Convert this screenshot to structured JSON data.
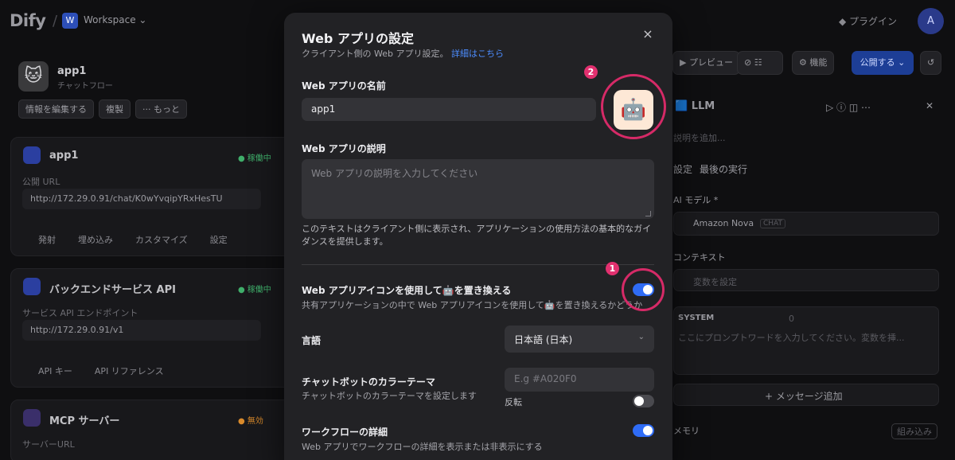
{
  "topbar": {
    "logo": "Dify",
    "workspace_badge": "W",
    "workspace_name": "Workspace ⌄",
    "plugins_label": "プラグイン",
    "avatar_letter": "A"
  },
  "left_panel": {
    "app_icon": "🐱",
    "app_name": "app1",
    "app_type": "チャットフロー",
    "chips": [
      "情報を編集する",
      "複製",
      "··· もっと"
    ],
    "webapp_card": {
      "title": "app1",
      "status": "● 稼働中",
      "url_label": "公開 URL",
      "url": "http://172.29.0.91/chat/K0wYvqipYRxHesTU",
      "actions": [
        "発射",
        "埋め込み",
        "カスタマイズ",
        "設定"
      ]
    },
    "api_card": {
      "title": "バックエンドサービス API",
      "status": "● 稼働中",
      "url_label": "サービス API エンドポイント",
      "url": "http://172.29.0.91/v1",
      "actions": [
        "API キー",
        "API リファレンス"
      ]
    },
    "mcp_card": {
      "title": "MCP サーバー",
      "status": "● 無効",
      "url_label": "サーバーURL",
      "url": "**********"
    }
  },
  "right_panel": {
    "preview_label": "プレビュー",
    "features_label": "機能",
    "publish_label": "公開する ⌄",
    "node_title": "LLM",
    "node_desc_placeholder": "説明を追加...",
    "tabs": [
      "設定",
      "最後の実行"
    ],
    "model_label": "AI モデル *",
    "model_name": "Amazon Nova",
    "model_tag": "CHAT",
    "context_label": "コンテキスト",
    "context_placeholder": "変数を設定",
    "system_label": "SYSTEM",
    "system_count": "0",
    "system_placeholder": "ここにプロンプトワードを入力してください。変数を挿...",
    "add_message": "+ メッセージ追加",
    "memory_label": "メモリ",
    "memory_value": "組み込み"
  },
  "modal": {
    "title": "Web アプリの設定",
    "subtitle": "クライアント側の Web アプリ設定。",
    "subtitle_link": "詳細はこちら",
    "close_glyph": "×",
    "name_label": "Web アプリの名前",
    "name_value": "app1",
    "app_icon": "🤖",
    "desc_label": "Web アプリの説明",
    "desc_placeholder": "Web アプリの説明を入力してください",
    "desc_help": "このテキストはクライアント側に表示され、アプリケーションの使用方法の基本的なガイダンスを提供します。",
    "replace_icon_label": "Web アプリアイコンを使用して🤖を置き換える",
    "replace_icon_desc": "共有アプリケーションの中で Web アプリアイコンを使用して🤖を置き換えるかどうか",
    "replace_icon_on": true,
    "language_label": "言語",
    "language_value": "日本語 (日本)",
    "color_theme_label": "チャットボットのカラーテーマ",
    "color_theme_desc": "チャットボットのカラーテーマを設定します",
    "color_placeholder": "E.g #A020F0",
    "invert_label": "反転",
    "invert_on": false,
    "workflow_label": "ワークフローの詳細",
    "workflow_desc": "Web アプリでワークフローの詳細を表示または非表示にする",
    "workflow_on": true
  },
  "annotations": {
    "badge_1": "1",
    "badge_2": "2",
    "color": "#d62a67"
  }
}
